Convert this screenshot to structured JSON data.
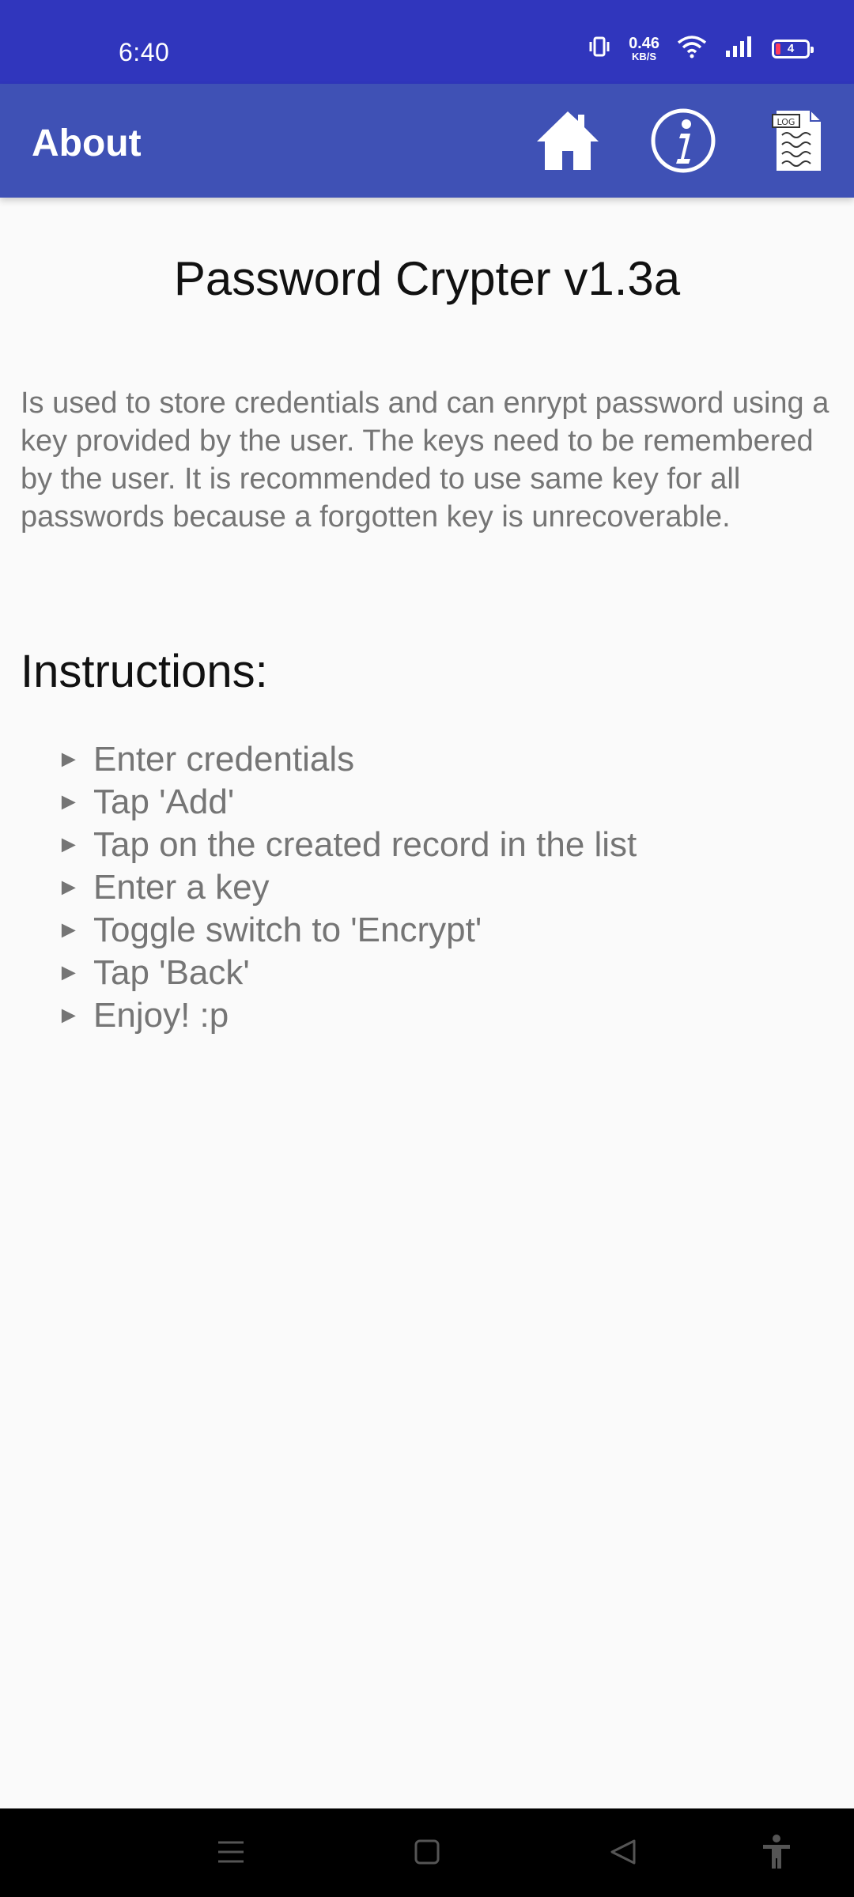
{
  "status_bar": {
    "time": "6:40",
    "net_speed_value": "0.46",
    "net_speed_unit": "KB/S",
    "battery_level": "4",
    "icons": [
      "vibrate-icon",
      "wifi-icon",
      "signal-icon",
      "battery-icon"
    ]
  },
  "app_bar": {
    "title": "About",
    "actions": [
      "home-icon",
      "info-icon",
      "log-icon"
    ],
    "log_badge": "LOG",
    "color": "#3f51b5"
  },
  "content": {
    "title": "Password Crypter v1.3a",
    "description": "Is used to store credentials and can enrypt password using a key provided by the user. The keys need to be remembered by the user. It is recommended to use same key for all passwords because a forgotten key is unrecoverable.",
    "instructions_heading": "Instructions:",
    "bullet": "►",
    "steps": [
      "Enter credentials",
      "Tap 'Add'",
      "Tap on the created record in the list",
      "Enter a key",
      "Toggle switch to 'Encrypt'",
      "Tap 'Back'",
      "Enjoy! :p"
    ]
  },
  "nav_bar": {
    "buttons": [
      "menu-icon",
      "home-square-icon",
      "back-triangle-icon",
      "accessibility-icon"
    ]
  },
  "colors": {
    "status_bar": "#3036bd",
    "app_bar": "#3f51b5",
    "background": "#fafafa",
    "secondary_text": "#757575"
  }
}
